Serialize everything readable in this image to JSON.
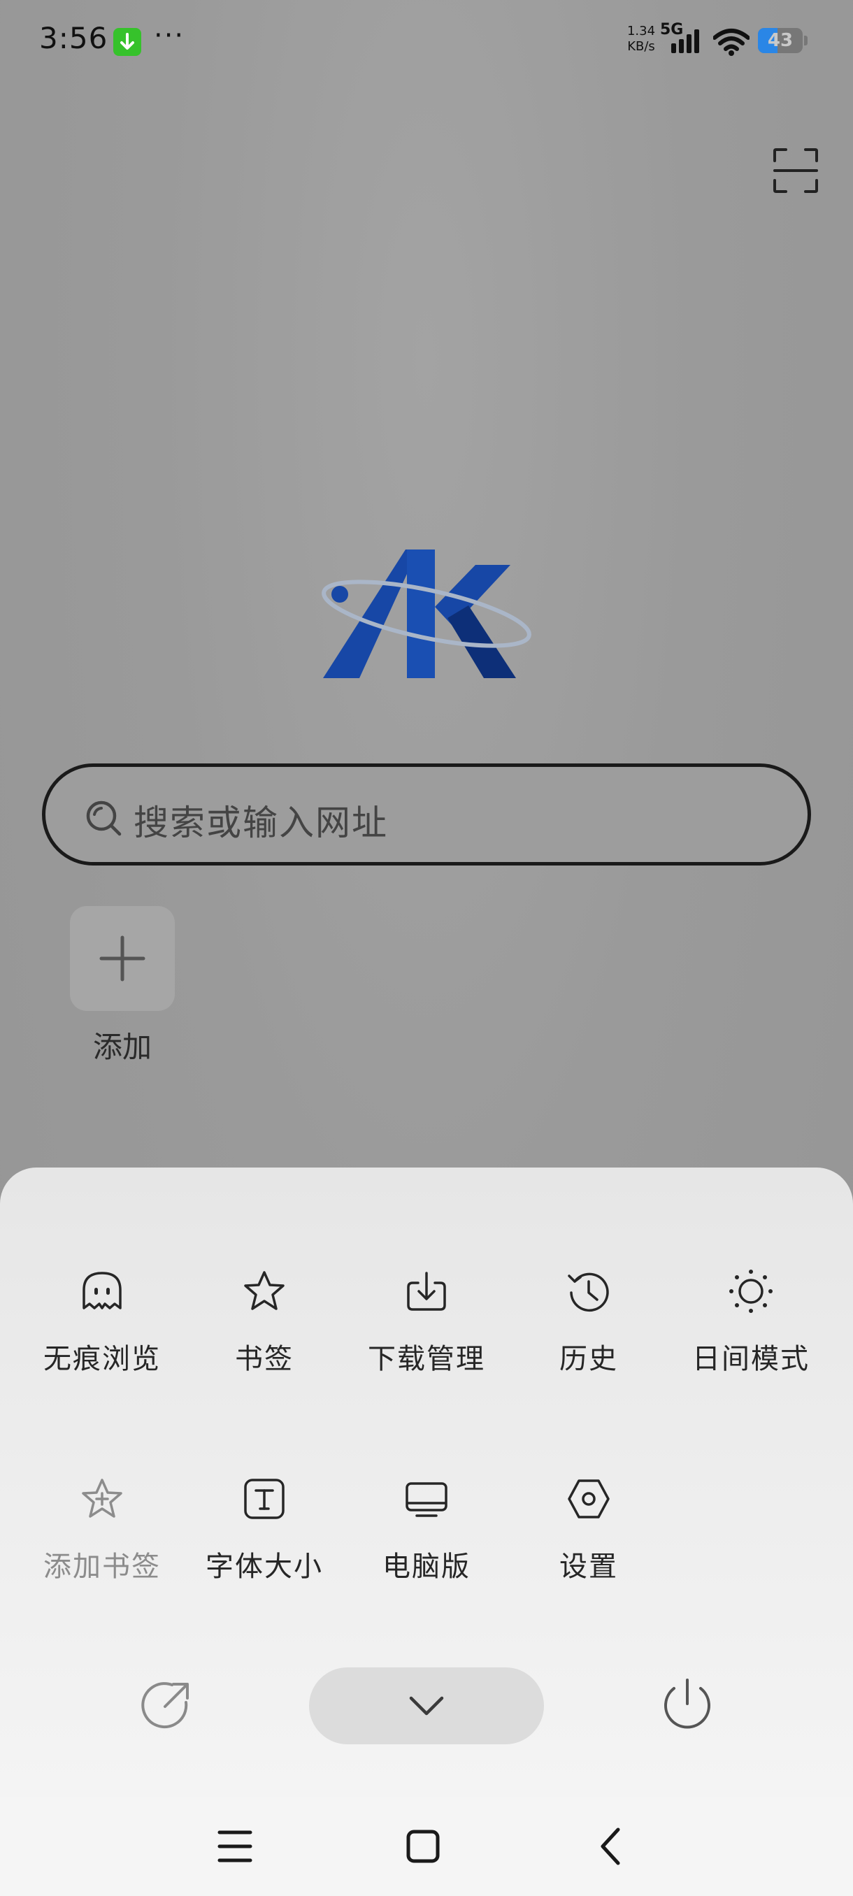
{
  "status_bar": {
    "time": "3:56",
    "more": "···",
    "net_speed_value": "1.34",
    "net_speed_unit": "KB/s",
    "network_type": "5G",
    "battery_percent": 43,
    "battery_label": "43",
    "download_icon": "download-arrow-icon",
    "signal_icon": "signal-bars-icon",
    "wifi_icon": "wifi-icon"
  },
  "header": {
    "scan_icon": "scan-icon"
  },
  "logo": {
    "colors": {
      "primary": "#1747a6",
      "dark": "#0d2f78",
      "orbit": "#aab6c8"
    }
  },
  "search": {
    "placeholder": "搜索或输入网址",
    "icon": "search-icon"
  },
  "shortcuts": {
    "add_label": "添加",
    "add_icon": "plus-icon"
  },
  "menu": {
    "row1": [
      {
        "label": "无痕浏览",
        "icon": "ghost-icon"
      },
      {
        "label": "书签",
        "icon": "star-icon"
      },
      {
        "label": "下载管理",
        "icon": "download-icon"
      },
      {
        "label": "历史",
        "icon": "history-icon"
      },
      {
        "label": "日间模式",
        "icon": "sun-icon"
      }
    ],
    "row2": [
      {
        "label": "添加书签",
        "icon": "star-plus-icon",
        "disabled": true
      },
      {
        "label": "字体大小",
        "icon": "font-size-icon"
      },
      {
        "label": "电脑版",
        "icon": "desktop-icon"
      },
      {
        "label": "设置",
        "icon": "settings-icon"
      }
    ],
    "actions": {
      "share_icon": "share-icon",
      "collapse_icon": "chevron-down-icon",
      "exit_icon": "power-icon"
    }
  },
  "nav_bar": {
    "menu_icon": "menu-icon",
    "home_icon": "home-square-icon",
    "back_icon": "back-chevron-icon"
  },
  "colors": {
    "accent_green": "#36c22b",
    "battery_blue": "#2a86e6",
    "scrim": "#9a9a9a",
    "sheet": "#eeeeee"
  }
}
